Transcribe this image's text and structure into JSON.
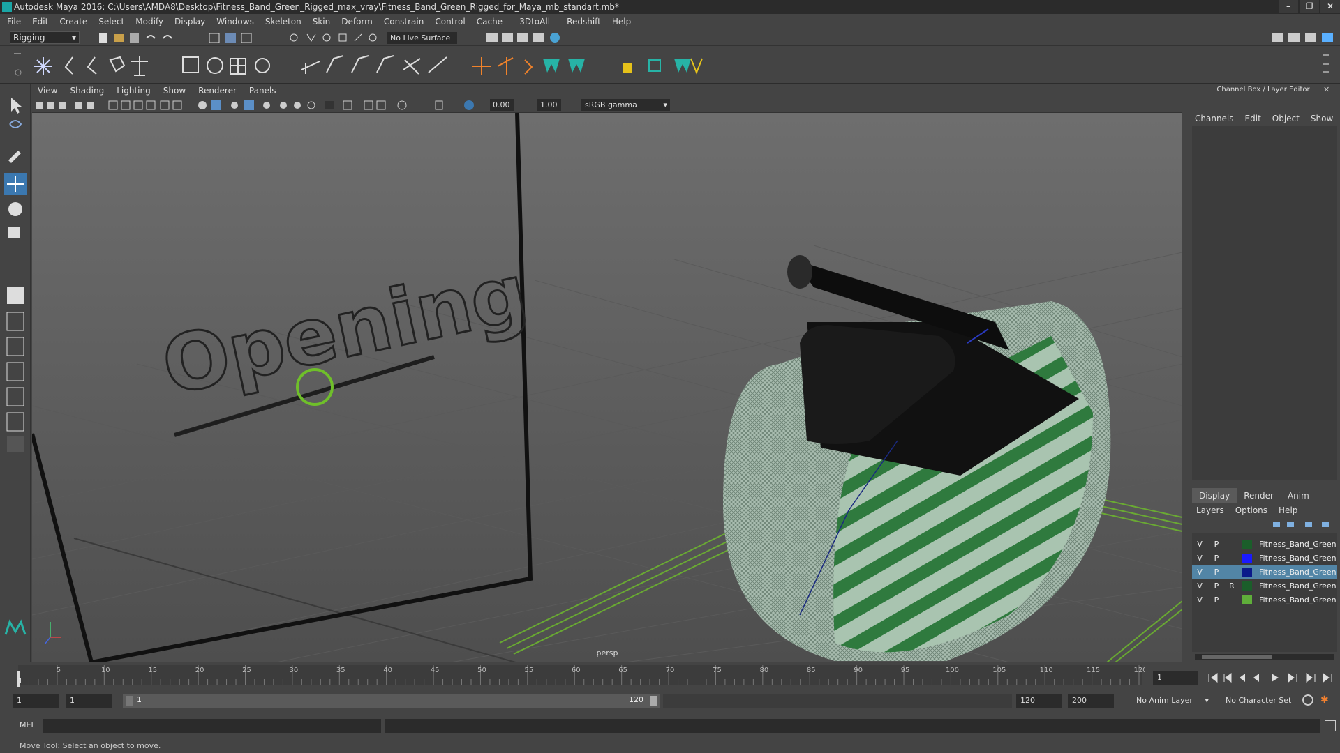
{
  "window": {
    "title": "Autodesk Maya 2016: C:\\Users\\AMDA8\\Desktop\\Fitness_Band_Green_Rigged_max_vray\\Fitness_Band_Green_Rigged_for_Maya_mb_standart.mb*",
    "minimize": "–",
    "restore": "❐",
    "close": "✕"
  },
  "menubar": [
    "File",
    "Edit",
    "Create",
    "Select",
    "Modify",
    "Display",
    "Windows",
    "Skeleton",
    "Skin",
    "Deform",
    "Constrain",
    "Control",
    "Cache",
    "- 3DtoAll -",
    "Redshift",
    "Help"
  ],
  "statusline": {
    "mode": "Rigging",
    "live_surface": "No Live Surface"
  },
  "panel_menu": [
    "View",
    "Shading",
    "Lighting",
    "Show",
    "Renderer",
    "Panels"
  ],
  "panel_tools": {
    "exposure": "0.00",
    "gamma": "1.00",
    "color_space": "sRGB gamma"
  },
  "viewport": {
    "camera_label": "persp",
    "text_object": "Opening"
  },
  "channel_box": {
    "title": "Channel Box / Layer Editor",
    "menu": [
      "Channels",
      "Edit",
      "Object",
      "Show"
    ]
  },
  "layer_editor": {
    "tabs": [
      "Display",
      "Render",
      "Anim"
    ],
    "active_tab": "Display",
    "menu": [
      "Layers",
      "Options",
      "Help"
    ],
    "layers": [
      {
        "v": "V",
        "p": "P",
        "r": "",
        "color": "#1b5e2a",
        "name": "Fitness_Band_Green_R",
        "selected": false
      },
      {
        "v": "V",
        "p": "P",
        "r": "",
        "color": "#1a1aff",
        "name": "Fitness_Band_Green_R",
        "selected": false
      },
      {
        "v": "V",
        "p": "P",
        "r": "",
        "color": "#0b1a8a",
        "name": "Fitness_Band_Green_R",
        "selected": true
      },
      {
        "v": "V",
        "p": "P",
        "r": "R",
        "color": "#1b5e2a",
        "name": "Fitness_Band_Green_R",
        "selected": false
      },
      {
        "v": "V",
        "p": "P",
        "r": "",
        "color": "#5fae3a",
        "name": "Fitness_Band_Green_R",
        "selected": false
      }
    ]
  },
  "timeline": {
    "ticks": [
      "5",
      "10",
      "15",
      "20",
      "25",
      "30",
      "35",
      "40",
      "45",
      "50",
      "55",
      "60",
      "65",
      "70",
      "75",
      "80",
      "85",
      "90",
      "95",
      "100",
      "105",
      "110",
      "115",
      "120"
    ],
    "start_marker": "1",
    "current_frame": "1"
  },
  "range": {
    "start": "1",
    "playback_start": "1",
    "slider_start": "1",
    "slider_end": "120",
    "playback_end": "120",
    "end": "200",
    "anim_layer": "No Anim Layer",
    "character_set": "No Character Set"
  },
  "command_line": {
    "label": "MEL"
  },
  "help_line": "Move Tool: Select an object to move."
}
